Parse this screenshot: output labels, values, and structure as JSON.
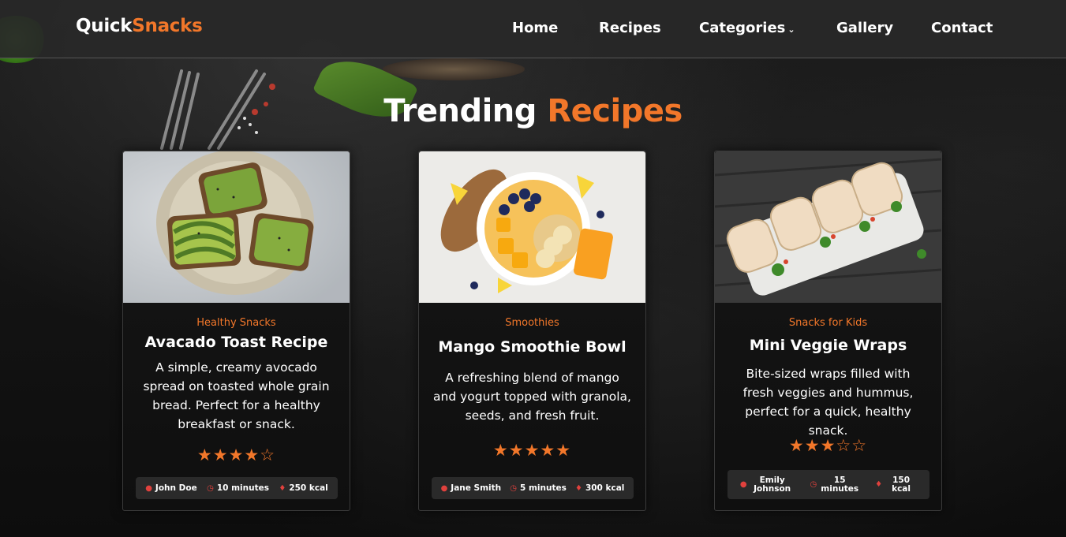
{
  "brand": {
    "part1": "Quick",
    "part2": "Snacks"
  },
  "nav": {
    "home": "Home",
    "recipes": "Recipes",
    "categories": "Categories",
    "gallery": "Gallery",
    "contact": "Contact"
  },
  "heading": {
    "part1": "Trending",
    "part2": "Recipes"
  },
  "cards": [
    {
      "category": "Healthy Snacks",
      "title": "Avacado Toast Recipe",
      "description": "A simple, creamy avocado spread on toasted whole grain bread. Perfect for a healthy breakfast or snack.",
      "rating": 4,
      "stars": "★★★★☆",
      "author": "John Doe",
      "time": "10 minutes",
      "calories": "250 kcal"
    },
    {
      "category": "Smoothies",
      "title": "Mango Smoothie Bowl",
      "description": "A refreshing blend of mango and yogurt topped with granola, seeds, and fresh fruit.",
      "rating": 5,
      "stars": "★★★★★",
      "author": "Jane Smith",
      "time": "5 minutes",
      "calories": "300 kcal"
    },
    {
      "category": "Snacks for Kids",
      "title": "Mini Veggie Wraps",
      "description": "Bite-sized wraps filled with fresh veggies and hummus, perfect for a quick, healthy snack.",
      "rating": 3,
      "stars": "★★★☆☆",
      "author": "Emily Johnson",
      "time": "15 minutes",
      "calories": "150 kcal"
    }
  ],
  "icons": {
    "author": "user-icon",
    "time": "timer-icon",
    "calories": "flame-icon"
  },
  "colors": {
    "accent": "#f2772a",
    "icon_red": "#e0413d",
    "navbar": "#282828",
    "card_meta": "#2a2a2a"
  }
}
